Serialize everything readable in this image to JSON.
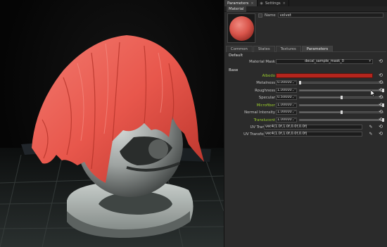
{
  "tabs": [
    {
      "label": "Parameters",
      "close": "×",
      "active": true
    },
    {
      "label": "Settings",
      "close": "×",
      "active": false
    }
  ],
  "material_header": "Material",
  "name": {
    "label": "Name",
    "value": "velvet"
  },
  "subtabs": [
    {
      "label": "Common",
      "active": false
    },
    {
      "label": "States",
      "active": false
    },
    {
      "label": "Textures",
      "active": false
    },
    {
      "label": "Parameters",
      "active": true
    }
  ],
  "default_section": {
    "title": "Default",
    "material_mask": {
      "label": "Material Mask",
      "value": "decal_sample_mask_0",
      "dropdown_icon": "▾"
    }
  },
  "base_section": {
    "title": "Base",
    "albedo": {
      "label": "Albedo",
      "color": "#b5251d",
      "label_color": "#9bcd2d"
    },
    "params": [
      {
        "label": "Metalness",
        "value": "0.00000",
        "slider": 0.0,
        "highlight": false
      },
      {
        "label": "Roughness",
        "value": "1.00000",
        "slider": 1.0,
        "highlight": false
      },
      {
        "label": "Specular",
        "value": "0.50000",
        "slider": 0.5,
        "highlight": false
      },
      {
        "label": "Microfiber",
        "value": "1.00000",
        "slider": 1.0,
        "highlight": true
      },
      {
        "label": "Normal Intensity",
        "value": "1.00000",
        "slider": 0.5,
        "highlight": false
      },
      {
        "label": "Translucent",
        "value": "1.00000",
        "slider": 1.0,
        "highlight": true
      }
    ],
    "transforms": [
      {
        "label": "UV Transform",
        "value": "vec4(1.0f,1.0f,0.0f,0.0f)"
      },
      {
        "label": "UV Transform AO",
        "value": "vec4(1.0f,1.0f,0.0f,0.0f)"
      }
    ]
  },
  "icons": {
    "reset": "reset-icon",
    "edit": "pencil-icon",
    "spin": "spin-arrows-icon",
    "cursor": "mouse-cursor-icon"
  },
  "colors": {
    "accent_green": "#9bcd2d",
    "cloth": "#e8574c",
    "albedo": "#b5251d"
  }
}
